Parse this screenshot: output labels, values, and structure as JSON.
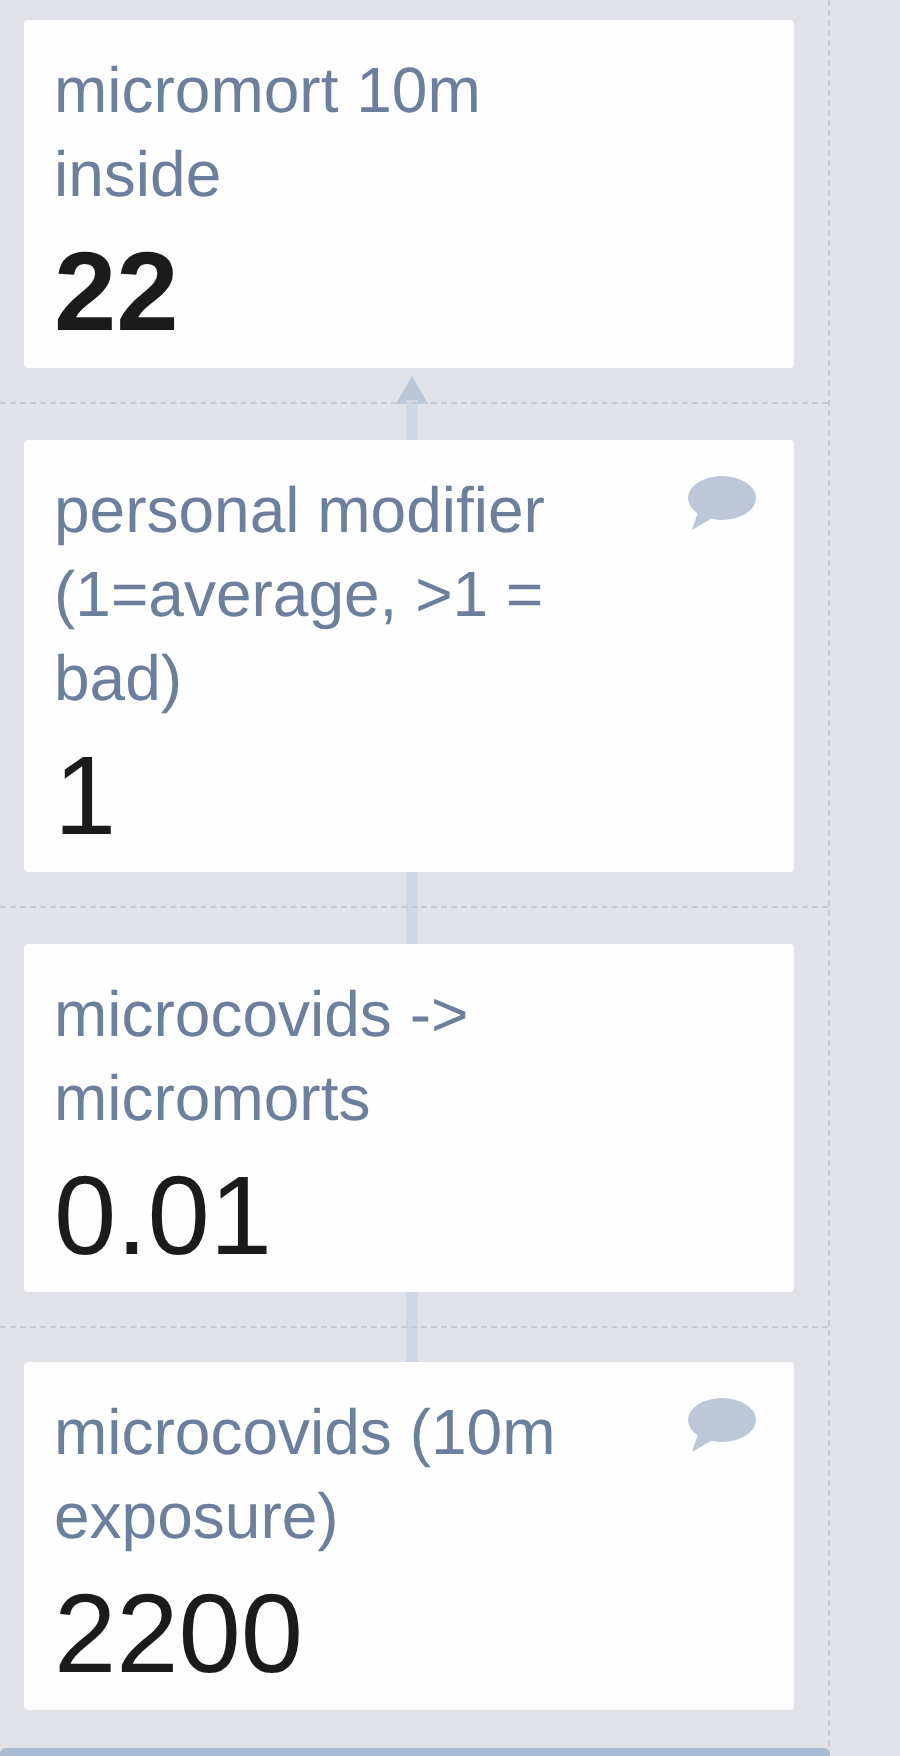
{
  "cells": [
    {
      "name": "micromort 10m inside",
      "value": "22",
      "output": true,
      "has_comment": false
    },
    {
      "name": "personal modifier (1=average, >1 = bad)",
      "value": "1",
      "output": false,
      "has_comment": true
    },
    {
      "name": "microcovids -> micromorts",
      "value": "0.01",
      "output": false,
      "has_comment": false
    },
    {
      "name": "microcovids (10m exposure)",
      "value": "2200",
      "output": false,
      "has_comment": true
    }
  ]
}
